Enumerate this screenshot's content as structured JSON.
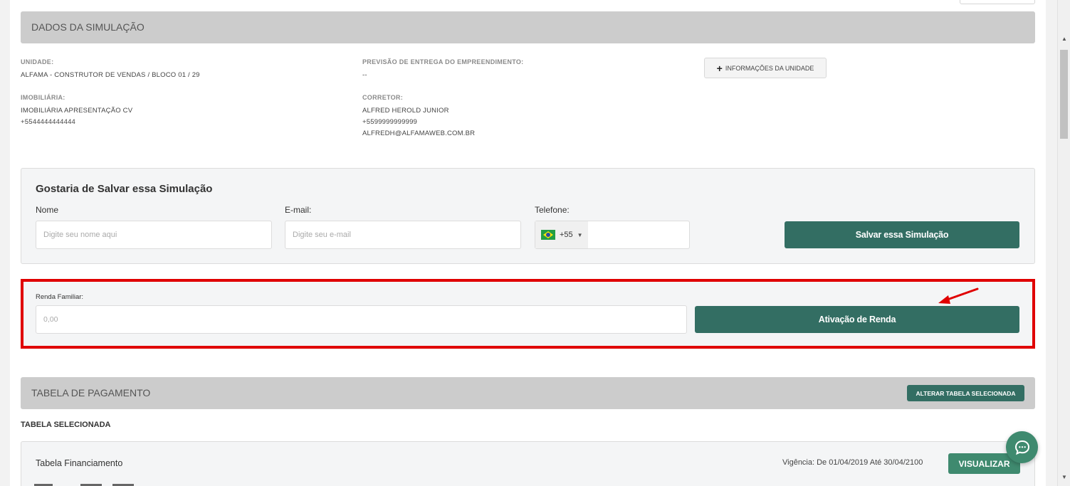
{
  "dados": {
    "header": "DADOS DA SIMULAÇÃO",
    "unidade_label": "UNIDADE:",
    "unidade_value": "ALFAMA - CONSTRUTOR DE VENDAS / BLOCO 01 / 29",
    "previsao_label": "PREVISÃO DE ENTREGA DO EMPREENDIMENTO:",
    "previsao_value": "--",
    "info_button": "INFORMAÇÕES DA UNIDADE",
    "imobiliaria_label": "IMOBILIÁRIA:",
    "imobiliaria_name": "IMOBILIÁRIA APRESENTAÇÃO CV",
    "imobiliaria_phone": "+5544444444444",
    "corretor_label": "CORRETOR:",
    "corretor_name": "ALFRED HEROLD JUNIOR",
    "corretor_phone": "+5599999999999",
    "corretor_email": "ALFREDH@ALFAMAWEB.COM.BR"
  },
  "save_form": {
    "title": "Gostaria de Salvar essa Simulação",
    "nome_label": "Nome",
    "nome_placeholder": "Digite seu nome aqui",
    "email_label": "E-mail:",
    "email_placeholder": "Digite seu e-mail",
    "telefone_label": "Telefone:",
    "country_code": "+55",
    "save_button": "Salvar essa Simulação"
  },
  "renda": {
    "label": "Renda Familiar:",
    "placeholder": "0,00",
    "button": "Ativação de Renda",
    "highlight_color": "#e00000"
  },
  "pagamento": {
    "header": "TABELA DE PAGAMENTO",
    "alter_button": "ALTERAR TABELA SELECIONADA",
    "selected_label": "TABELA SELECIONADA",
    "table_name": "Tabela Financiamento",
    "vigencia": "Vigência: De 01/04/2019 Até 30/04/2100",
    "view_button": "VISUALIZAR"
  },
  "colors": {
    "primary_green": "#336e63",
    "accent_green": "#3f8a6f",
    "header_gray": "#cccccc"
  },
  "icons": {
    "info": "plus-icon",
    "chat": "chat-bubble-icon",
    "flag": "brazil-flag-icon",
    "annotation": "red-arrow-icon"
  }
}
